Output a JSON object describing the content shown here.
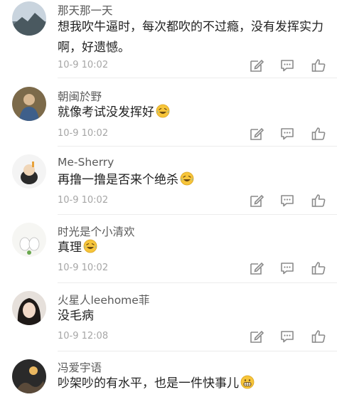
{
  "comments": [
    {
      "name": "那天那一天",
      "lines": [
        "想我吹牛逼时，每次都吹的不过瘾，没有发挥实力",
        "啊，好遗憾。"
      ],
      "emoji": "",
      "time": "10-9 10:02"
    },
    {
      "name": "朝闽於野",
      "lines": [
        "就像考试没发挥好"
      ],
      "emoji": "laughing-tears-emoji",
      "time": "10-9 10:02"
    },
    {
      "name": "Me-Sherry",
      "lines": [
        "再撸一撸是否来个绝杀"
      ],
      "emoji": "laughing-tears-emoji",
      "time": "10-9 10:02"
    },
    {
      "name": "时光是个小清欢",
      "lines": [
        "真理"
      ],
      "emoji": "laughing-tears-emoji",
      "time": "10-9 10:02"
    },
    {
      "name": "火星人leehome菲",
      "lines": [
        "没毛病"
      ],
      "emoji": "",
      "time": "10-9 12:08"
    },
    {
      "name": "冯爱宇语",
      "lines": [
        "吵架吵的有水平，也是一件快事儿"
      ],
      "emoji": "grinning-emoji",
      "time": ""
    }
  ],
  "icons": {
    "edit": "edit-square-icon",
    "reply": "comment-bubble-icon",
    "like": "thumbs-up-icon"
  },
  "colors": {
    "name": "#5a5a5a",
    "text": "#222222",
    "time": "#a6a6a6",
    "icon": "#8a8a8a",
    "emoji": "#f7c53a"
  }
}
